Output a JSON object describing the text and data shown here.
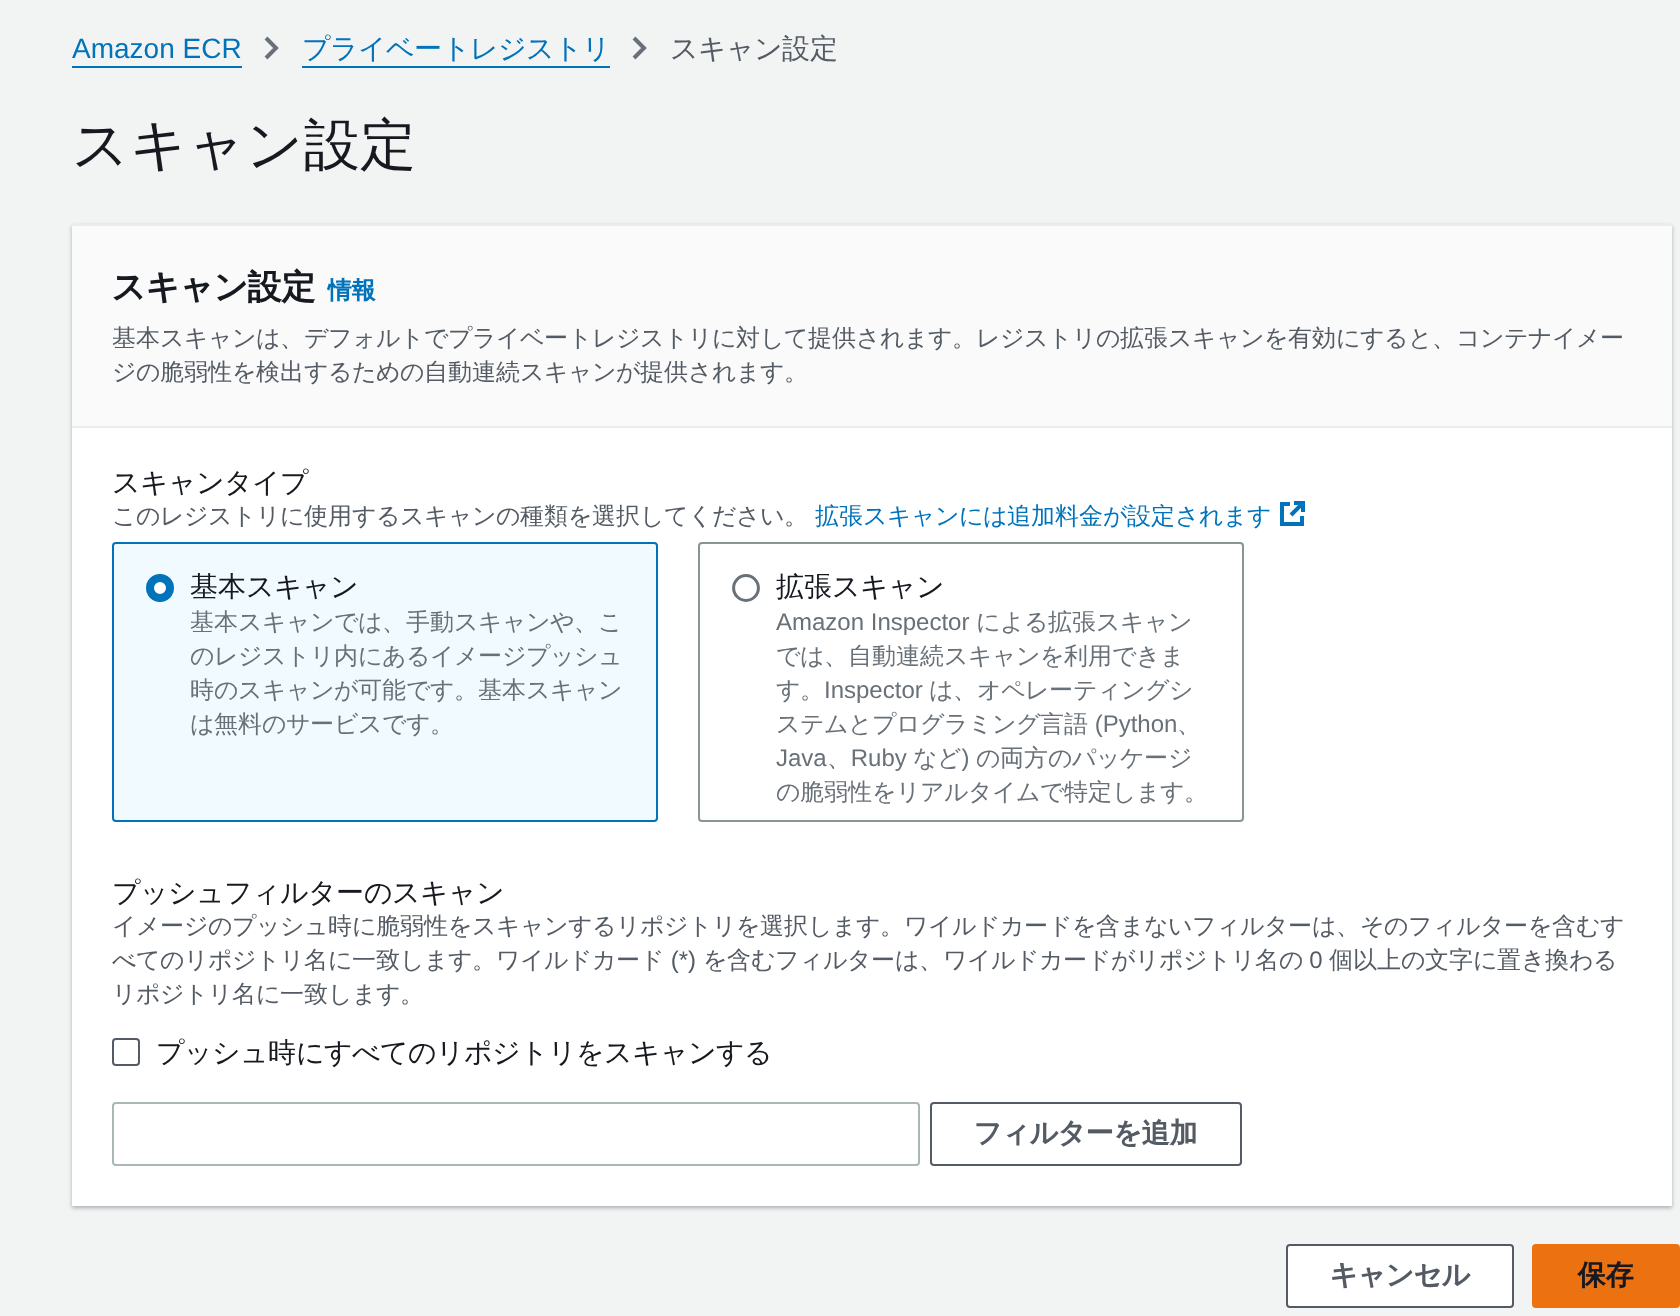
{
  "breadcrumb": [
    {
      "label": "Amazon ECR",
      "kind": "link"
    },
    {
      "label": "プライベートレジストリ",
      "kind": "link"
    },
    {
      "label": "スキャン設定",
      "kind": "current"
    }
  ],
  "title": "スキャン設定",
  "panel": {
    "title": "スキャン設定",
    "info_link": "情報",
    "description": "基本スキャンは、デフォルトでプライベートレジストリに対して提供されます。レジストリの拡張スキャンを有効にすると、コンテナイメージの脆弱性を検出するための自動連続スキャンが提供されます。",
    "scan_type": {
      "label": "スキャンタイプ",
      "description": "このレジストリに使用するスキャンの種類を選択してください。",
      "link": "拡張スキャンには追加料金が設定されます"
    },
    "options": [
      {
        "title": "基本スキャン",
        "description": "基本スキャンでは、手動スキャンや、このレジストリ内にあるイメージプッシュ時のスキャンが可能です。基本スキャンは無料のサービスです。",
        "selected": true
      },
      {
        "title": "拡張スキャン",
        "description": "Amazon Inspector による拡張スキャンでは、自動連続スキャンを利用できます。Inspector は、オペレーティングシステムとプログラミング言語 (Python、Java、Ruby など) の両方のパッケージの脆弱性をリアルタイムで特定します。",
        "selected": false
      }
    ],
    "push_filter": {
      "title": "プッシュフィルターのスキャン",
      "description": "イメージのプッシュ時に脆弱性をスキャンするリポジトリを選択します。ワイルドカードを含まないフィルターは、そのフィルターを含むすべてのリポジトリ名に一致します。ワイルドカード (*) を含むフィルターは、ワイルドカードがリポジトリ名の 0 個以上の文字に置き換わるリポジトリ名に一致します。",
      "checkbox": {
        "label": "プッシュ時にすべてのリポジトリをスキャンする",
        "checked": false
      },
      "add_button": "フィルターを追加"
    }
  },
  "footer_buttons": [
    {
      "label": "キャンセル",
      "kind": "secondary"
    },
    {
      "label": "保存",
      "kind": "primary"
    }
  ]
}
